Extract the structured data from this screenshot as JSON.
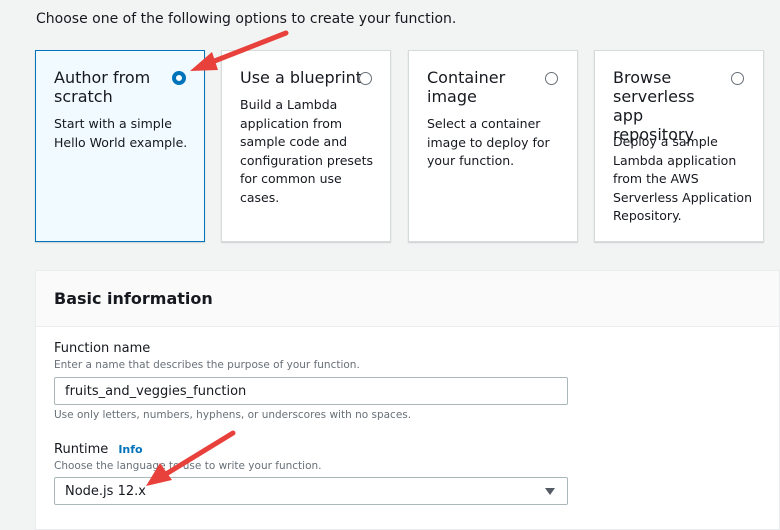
{
  "intro": "Choose one of the following options to create your function.",
  "options": [
    {
      "title": "Author from scratch",
      "description": "Start with a simple Hello World example.",
      "selected": true
    },
    {
      "title": "Use a blueprint",
      "description": "Build a Lambda application from sample code and configuration presets for common use cases.",
      "selected": false
    },
    {
      "title": "Container image",
      "description": "Select a container image to deploy for your function.",
      "selected": false
    },
    {
      "title": "Browse serverless app repository",
      "description": "Deploy a sample Lambda application from the AWS Serverless Application Repository.",
      "selected": false
    }
  ],
  "basic_info": {
    "title": "Basic information",
    "function_name": {
      "label": "Function name",
      "description": "Enter a name that describes the purpose of your function.",
      "value": "fruits_and_veggies_function",
      "constraint": "Use only letters, numbers, hyphens, or underscores with no spaces."
    },
    "runtime": {
      "label": "Runtime",
      "info": "Info",
      "description": "Choose the language to use to write your function.",
      "value": "Node.js 12.x"
    }
  },
  "colors": {
    "accent": "#0073bb",
    "annotation_arrow": "#e8403a"
  }
}
